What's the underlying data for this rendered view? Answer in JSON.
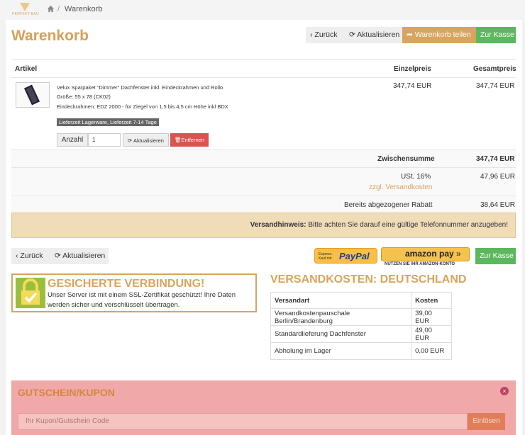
{
  "header": {
    "logo_text": "PERFEKT-BAU",
    "breadcrumb_separator": "/",
    "breadcrumb_current": "Warenkorb"
  },
  "page": {
    "title": "Warenkorb"
  },
  "toolbar": {
    "back": "Zurück",
    "refresh": "Aktualisieren",
    "share": "Warenkorb teilen",
    "checkout": "Zur Kasse"
  },
  "cart": {
    "headers": {
      "article": "Artikel",
      "unit_price": "Einzelpreis",
      "total_price": "Gesamtpreis"
    },
    "item": {
      "name": "Velux Sparpaket \"Dimmer\" Dachfenster inkl. Eindeckrahmen und Rollo",
      "size": "Größe: 55 x 78 (CK02)",
      "frame": "Eindeckrahmen: EDZ 2000 - für Ziegel von 1,5 bis 4,5 cm Höhe inkl BDX",
      "delivery_badge": "Lieferzeit Lagerware, Lieferzeit 7-14 Tage",
      "qty_label": "Anzahl",
      "qty_value": "1",
      "refresh_label": "Aktualisieren",
      "remove_label": "Entfernen",
      "unit_price": "347,74 EUR",
      "total_price": "347,74 EUR"
    },
    "subtotal_label": "Zwischensumme",
    "subtotal_value": "347,74 EUR",
    "vat_label": "USt. 16%",
    "shipping_link": "zzgl. Versandkosten",
    "vat_value": "47,96 EUR",
    "discount_label": "Bereits abgezogener Rabatt",
    "discount_value": "38,64 EUR"
  },
  "notice": {
    "label": "Versandhinweis:",
    "text": " Bitte achten Sie darauf eine gültige Telefonnummer anzugeben!"
  },
  "bottom_toolbar": {
    "back": "Zurück",
    "refresh": "Aktualisieren",
    "paypal_small": "Express-Kauf mit",
    "paypal_brand": "PayPal",
    "amazon_brand": "amazon pay",
    "amazon_sub": "NUTZEN SIE IHR AMAZON-KONTO",
    "checkout": "Zur Kasse"
  },
  "ssl": {
    "title": "GESICHERTE VERBINDUNG!",
    "text": "Unser Server ist mit einem SSL-Zertifikat geschützt! Ihre Daten werden sicher und verschlüsselt übertragen."
  },
  "shipping": {
    "title": "VERSANDKOSTEN: DEUTSCHLAND",
    "headers": [
      "Versandart",
      "Kosten"
    ],
    "rows": [
      [
        "Versandkostenpauschale Berlin/Brandenburg",
        "39,00 EUR"
      ],
      [
        "Standardlieferung Dachfenster",
        "49,00 EUR"
      ],
      [
        "Abholung im Lager",
        "0,00 EUR"
      ]
    ]
  },
  "coupon": {
    "title": "GUTSCHEIN/KUPON",
    "placeholder": "Ihr Kupon/Gutschein Code",
    "button": "Einlösen"
  }
}
